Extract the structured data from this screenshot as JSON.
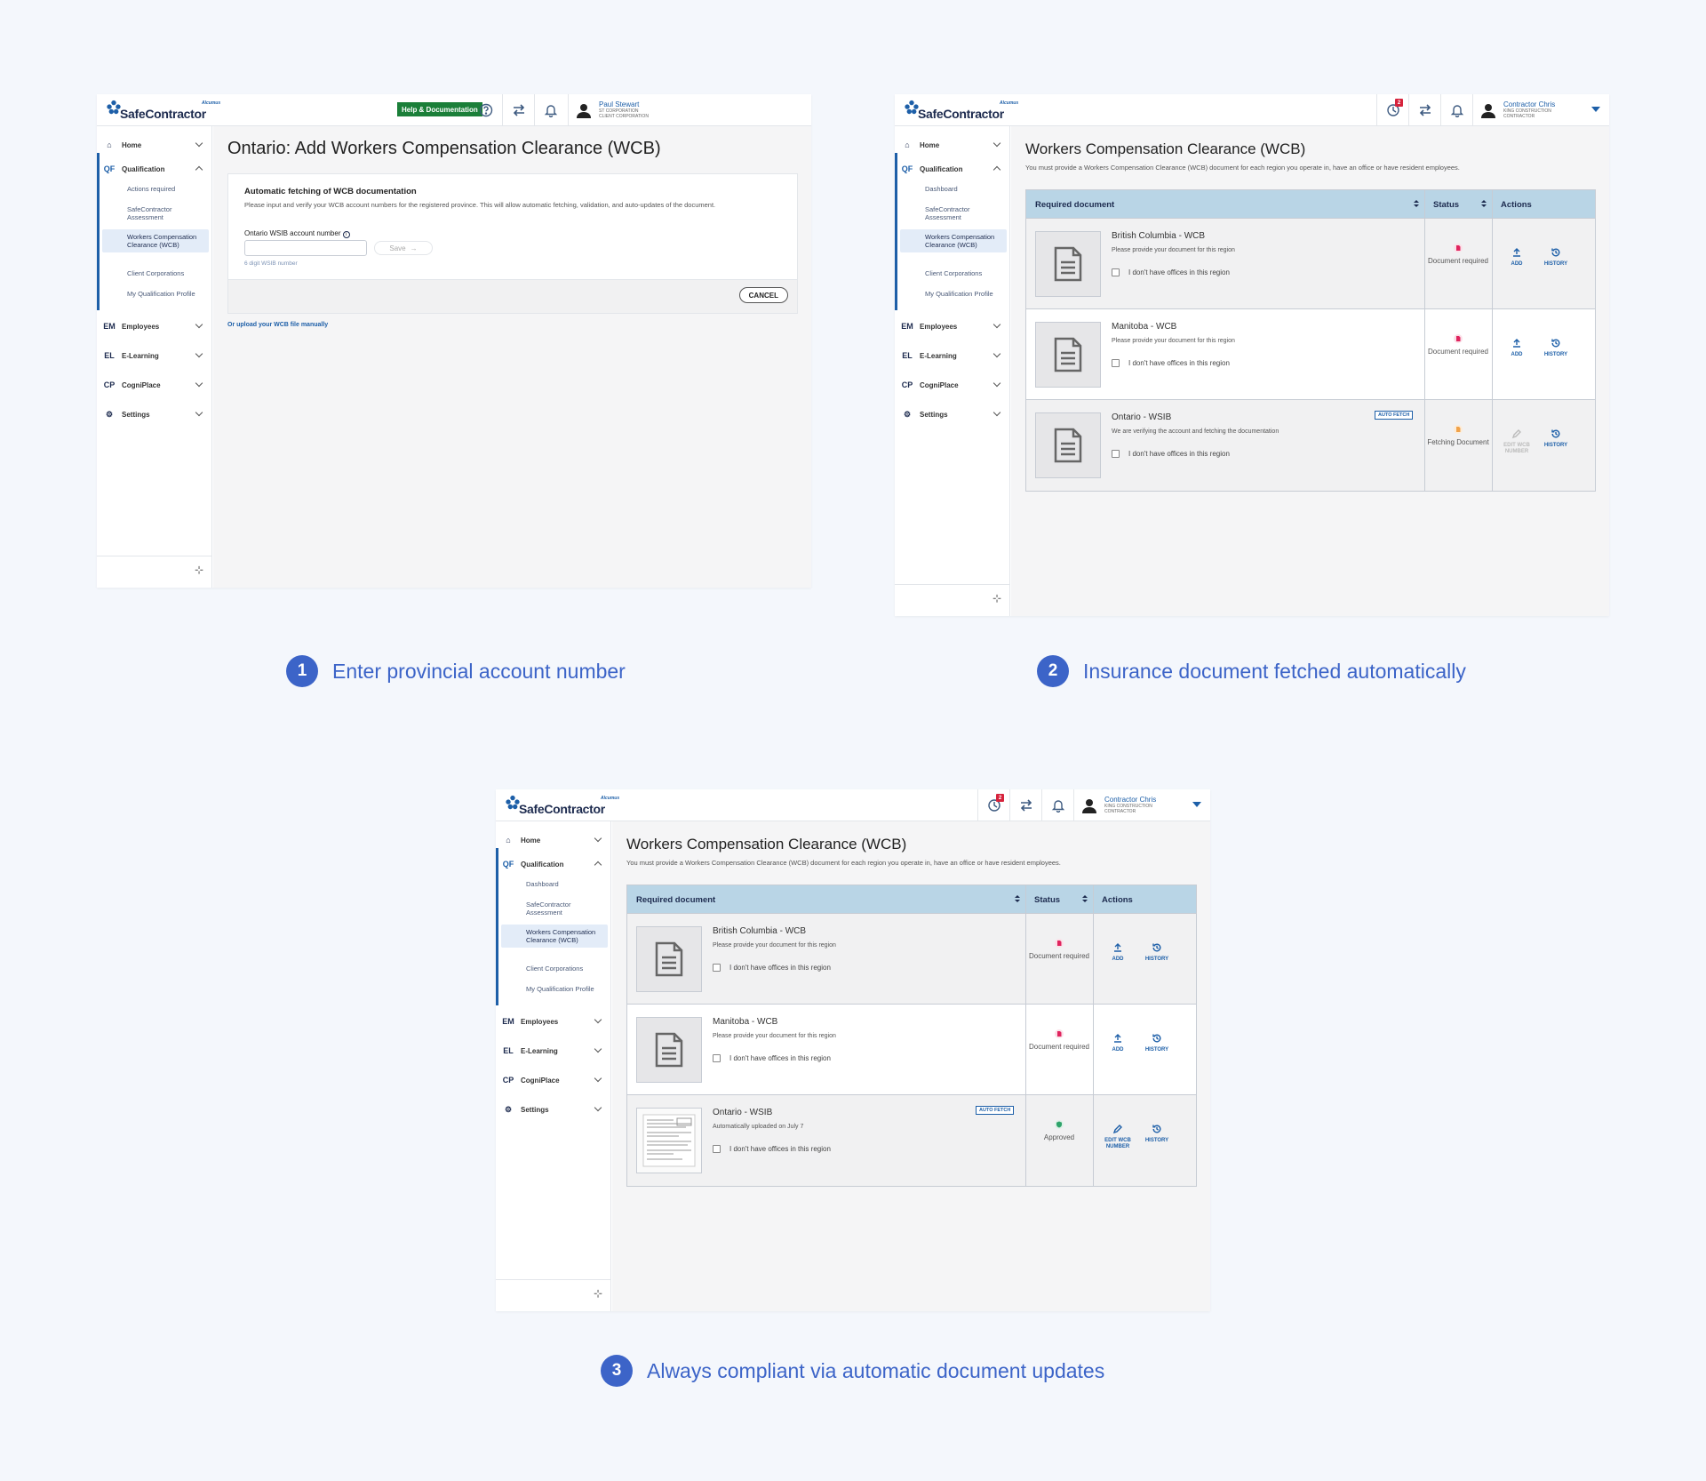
{
  "logo": {
    "word": "SafeContractor",
    "brand": "Alcumus"
  },
  "steps": [
    {
      "number": "1",
      "label": "Enter provincial account number"
    },
    {
      "number": "2",
      "label": "Insurance document fetched automatically"
    },
    {
      "number": "3",
      "label": "Always compliant via automatic document updates"
    }
  ],
  "panel1": {
    "help_label": "Help & Documentation",
    "user": {
      "name": "Paul Stewart",
      "line1": "ST CORPORATION",
      "line2": "CLIENT CORPORATION"
    },
    "sidebar": {
      "home": "Home",
      "qualification_code": "QF",
      "qualification": "Qualification",
      "sub": [
        "Actions required",
        "SafeContractor Assessment",
        "Workers Compensation Clearance (WCB)",
        "Client Corporations",
        "My Qualification Profile"
      ],
      "employees_code": "EM",
      "employees": "Employees",
      "elearning_code": "EL",
      "elearning": "E-Learning",
      "cogni_code": "CP",
      "cogni": "CogniPlace",
      "settings": "Settings"
    },
    "title": "Ontario: Add Workers Compensation Clearance (WCB)",
    "card": {
      "heading": "Automatic fetching of WCB documentation",
      "desc": "Please input and verify your WCB account numbers for the registered province. This will allow automatic fetching, validation, and auto-updates of the document.",
      "field_label": "Ontario WSIB account number",
      "field_value": "",
      "save_label": "Save",
      "hint": "6 digit WSIB number",
      "cancel_label": "CANCEL"
    },
    "upload_link": "Or upload your WCB file manually"
  },
  "panel2": {
    "badge": "2",
    "user": {
      "name": "Contractor Chris",
      "line1": "KING CONSTRUCTION",
      "line2": "CONTRACTOR"
    },
    "sidebar": {
      "home": "Home",
      "qualification_code": "QF",
      "qualification": "Qualification",
      "sub": [
        "Dashboard",
        "SafeContractor Assessment",
        "Workers Compensation Clearance (WCB)",
        "Client Corporations",
        "My Qualification Profile"
      ],
      "employees_code": "EM",
      "employees": "Employees",
      "elearning_code": "EL",
      "elearning": "E-Learning",
      "cogni_code": "CP",
      "cogni": "CogniPlace",
      "settings": "Settings"
    },
    "title": "Workers Compensation Clearance (WCB)",
    "desc": "You must provide a Workers Compensation Clearance (WCB) document for each region you operate in, have an office or have resident employees.",
    "headers": {
      "doc": "Required document",
      "status": "Status",
      "actions": "Actions"
    },
    "rows": [
      {
        "name": "British Columbia - WCB",
        "desc": "Please provide your document for this region",
        "check": "I don't have offices in this region",
        "status": "Document required",
        "action1": "ADD",
        "action2": "HISTORY"
      },
      {
        "name": "Manitoba - WCB",
        "desc": "Please provide your document for this region",
        "check": "I don't have offices in this region",
        "status": "Document required",
        "action1": "ADD",
        "action2": "HISTORY"
      },
      {
        "name": "Ontario - WSIB",
        "desc": "We are verifying the account and fetching the documentation",
        "check": "I don't have offices in this region",
        "status": "Fetching Document",
        "autofetch": "AUTO FETCH",
        "action1": "EDIT WCB NUMBER",
        "action2": "HISTORY"
      }
    ]
  },
  "panel3": {
    "badge": "2",
    "user": {
      "name": "Contractor Chris",
      "line1": "KING CONSTRUCTION",
      "line2": "CONTRACTOR"
    },
    "sidebar": {
      "home": "Home",
      "qualification_code": "QF",
      "qualification": "Qualification",
      "sub": [
        "Dashboard",
        "SafeContractor Assessment",
        "Workers Compensation Clearance (WCB)",
        "Client Corporations",
        "My Qualification Profile"
      ],
      "employees_code": "EM",
      "employees": "Employees",
      "elearning_code": "EL",
      "elearning": "E-Learning",
      "cogni_code": "CP",
      "cogni": "CogniPlace",
      "settings": "Settings"
    },
    "title": "Workers Compensation Clearance (WCB)",
    "desc": "You must provide a Workers Compensation Clearance (WCB) document for each region you operate in, have an office or have resident employees.",
    "headers": {
      "doc": "Required document",
      "status": "Status",
      "actions": "Actions"
    },
    "rows": [
      {
        "name": "British Columbia - WCB",
        "desc": "Please provide your document for this region",
        "check": "I don't have offices in this region",
        "status": "Document required",
        "action1": "ADD",
        "action2": "HISTORY"
      },
      {
        "name": "Manitoba - WCB",
        "desc": "Please provide your document for this region",
        "check": "I don't have offices in this region",
        "status": "Document required",
        "action1": "ADD",
        "action2": "HISTORY"
      },
      {
        "name": "Ontario - WSIB",
        "desc": "Automatically uploaded on July 7",
        "check": "I don't have offices in this region",
        "status": "Approved",
        "autofetch": "AUTO FETCH",
        "action1": "EDIT WCB NUMBER",
        "action2": "HISTORY"
      }
    ]
  },
  "colors": {
    "accent": "#1d5fa8",
    "step": "#3c64c8",
    "header": "#b9d5e6",
    "help": "#1b7f39",
    "required": "#e0245e",
    "fetching": "#f0a24a",
    "approved": "#2fa36b"
  }
}
